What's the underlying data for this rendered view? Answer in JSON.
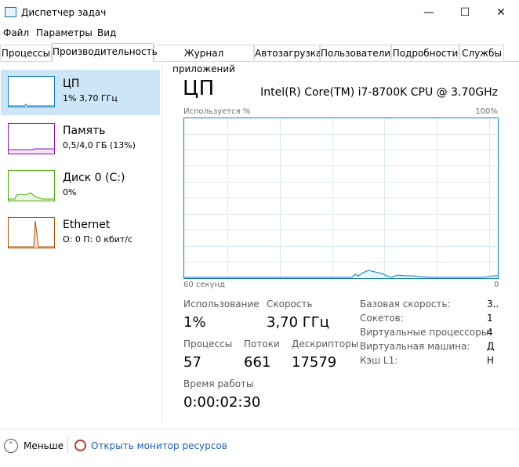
{
  "window": {
    "title": "Диспетчер задач",
    "controls": {
      "minimize": "—",
      "maximize": "☐",
      "close": "✕"
    }
  },
  "menu": [
    "Файл",
    "Параметры",
    "Вид"
  ],
  "tabs": [
    "Процессы",
    "Производительность",
    "Журнал приложений",
    "Автозагрузка",
    "Пользователи",
    "Подробности",
    "Службы"
  ],
  "active_tab": "Производительность",
  "sidebar": [
    {
      "name": "ЦП",
      "detail": "1% 3,70 ГГц",
      "color": "#117dbb"
    },
    {
      "name": "Память",
      "detail": "0,5/4,0 ГБ (13%)",
      "color": "#8b12ae"
    },
    {
      "name": "Диск 0 (C:)",
      "detail": "0%",
      "color": "#4da60c"
    },
    {
      "name": "Ethernet",
      "detail": "О: 0 П: 0 кбит/с",
      "color": "#a74f01"
    }
  ],
  "cpu": {
    "title": "ЦП",
    "model": "Intel(R) Core(TM) i7-8700K CPU @ 3.70GHz",
    "usage_label": "Используется %",
    "usage_max": "100%",
    "time_left": "60 секунд",
    "time_right": "0",
    "stats": {
      "usage_label": "Использование",
      "usage_value": "1%",
      "speed_label": "Скорость",
      "speed_value": "3,70 ГГц",
      "processes_label": "Процессы",
      "processes_value": "57",
      "threads_label": "Потоки",
      "threads_value": "661",
      "handles_label": "Дескрипторы",
      "handles_value": "17579",
      "uptime_label": "Время работы",
      "uptime_value": "0:00:02:30"
    },
    "specs": [
      {
        "label": "Базовая скорость:",
        "value": "3.."
      },
      {
        "label": "Сокетов:",
        "value": "1"
      },
      {
        "label": "Виртуальные процессоры:",
        "value": "4"
      },
      {
        "label": "Виртуальная машина:",
        "value": "Д"
      },
      {
        "label": "Кэш L1:",
        "value": "Н"
      }
    ]
  },
  "bottom": {
    "fewer_label": "Меньше",
    "monitor_link": "Открыть монитор ресурсов"
  }
}
